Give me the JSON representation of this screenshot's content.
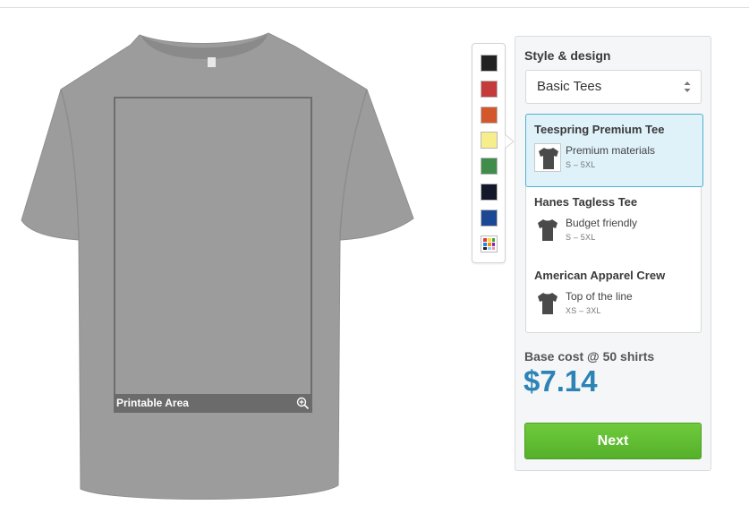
{
  "shirt": {
    "printable_area_label": "Printable Area",
    "base_color": "#9a9a9a",
    "zoom_icon": "zoom-in-icon"
  },
  "colors": {
    "swatches": [
      {
        "name": "black",
        "hex": "#222222"
      },
      {
        "name": "red",
        "hex": "#c53a3a"
      },
      {
        "name": "orange",
        "hex": "#d4562b"
      },
      {
        "name": "yellow",
        "hex": "#f6ee8a"
      },
      {
        "name": "green",
        "hex": "#3f8c4b"
      },
      {
        "name": "navy",
        "hex": "#13192a"
      },
      {
        "name": "royal-blue",
        "hex": "#1b4894"
      },
      {
        "name": "more-colors",
        "hex": "multicolor"
      }
    ]
  },
  "panel": {
    "title": "Style & design",
    "style_select": "Basic Tees",
    "products": [
      {
        "name": "Teespring Premium Tee",
        "desc": "Premium materials",
        "sizes": "S – 5XL",
        "selected": true
      },
      {
        "name": "Hanes Tagless Tee",
        "desc": "Budget friendly",
        "sizes": "S – 5XL",
        "selected": false
      },
      {
        "name": "American Apparel Crew",
        "desc": "Top of the line",
        "sizes": "XS – 3XL",
        "selected": false
      }
    ],
    "cost_label": "Base cost @ 50 shirts",
    "cost_value": "$7.14",
    "next_label": "Next",
    "accent_color": "#2b83b6",
    "button_color": "#5dbb30"
  }
}
